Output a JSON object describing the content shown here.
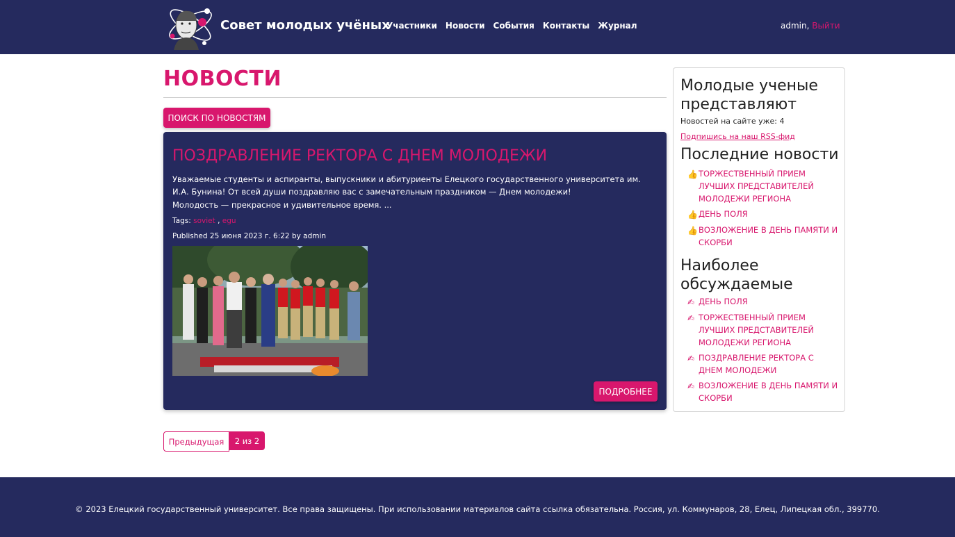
{
  "header": {
    "site_title": "Совет молодых учёных",
    "nav": [
      "Участники",
      "Новости",
      "События",
      "Контакты",
      "Журнал"
    ],
    "user": "admin,",
    "logout": "Выйти"
  },
  "main": {
    "heading": "НОВОСТИ",
    "search_button": "ПОИСК ПО НОВОСТЯМ",
    "article": {
      "title": "ПОЗДРАВЛЕНИЕ РЕКТОРА С ДНЕМ МОЛОДЕЖИ",
      "excerpt": "Уважаемые студенты и аспиранты, выпускники и абитуриенты Елецкого государственного университета им. И.А. Бунина! От всей души поздравляю вас с замечательным праздником — Днем молодежи!",
      "excerpt2": "Молодость — прекрасное и удивительное время. ...",
      "tags_label": "Tags:",
      "tags": [
        "soviet",
        "egu"
      ],
      "published": "Published 25 июня 2023 г. 6:22 by admin",
      "more_button": "ПОДРОБНЕЕ"
    },
    "pagination": {
      "prev": "Предыдущая",
      "current": "2 из 2"
    }
  },
  "sidebar": {
    "heading1": "Молодые ученые представляют",
    "news_count": "Новостей на сайте уже: 4",
    "rss": "Подпишись на наш RSS-фид",
    "latest_heading": "Последние новости",
    "latest": [
      "ТОРЖЕСТВЕННЫЙ ПРИЕМ ЛУЧШИХ ПРЕДСТАВИТЕЛЕЙ МОЛОДЕЖИ РЕГИОНА",
      "ДЕНЬ ПОЛЯ",
      "ВОЗЛОЖЕНИЕ В ДЕНЬ ПАМЯТИ И СКОРБИ"
    ],
    "discussed_heading": "Наиболее обсуждаемые",
    "discussed": [
      "ДЕНЬ ПОЛЯ",
      "ТОРЖЕСТВЕННЫЙ ПРИЕМ ЛУЧШИХ ПРЕДСТАВИТЕЛЕЙ МОЛОДЕЖИ РЕГИОНА",
      "ПОЗДРАВЛЕНИЕ РЕКТОРА С ДНЕМ МОЛОДЕЖИ",
      "ВОЗЛОЖЕНИЕ В ДЕНЬ ПАМЯТИ И СКОРБИ"
    ]
  },
  "footer": {
    "text": "© 2023 Елецкий государственный университет. Все права защищены. При использовании материалов сайта ссылка обязательна. Россия, ул. Коммунаров, 28, Елец, Липецкая обл., 399770."
  },
  "colors": {
    "navy": "#252a5e",
    "accent": "#d8176d"
  },
  "icons": {
    "latest_item": "thumbs-up-icon",
    "discussed_item": "writing-hand-icon"
  }
}
